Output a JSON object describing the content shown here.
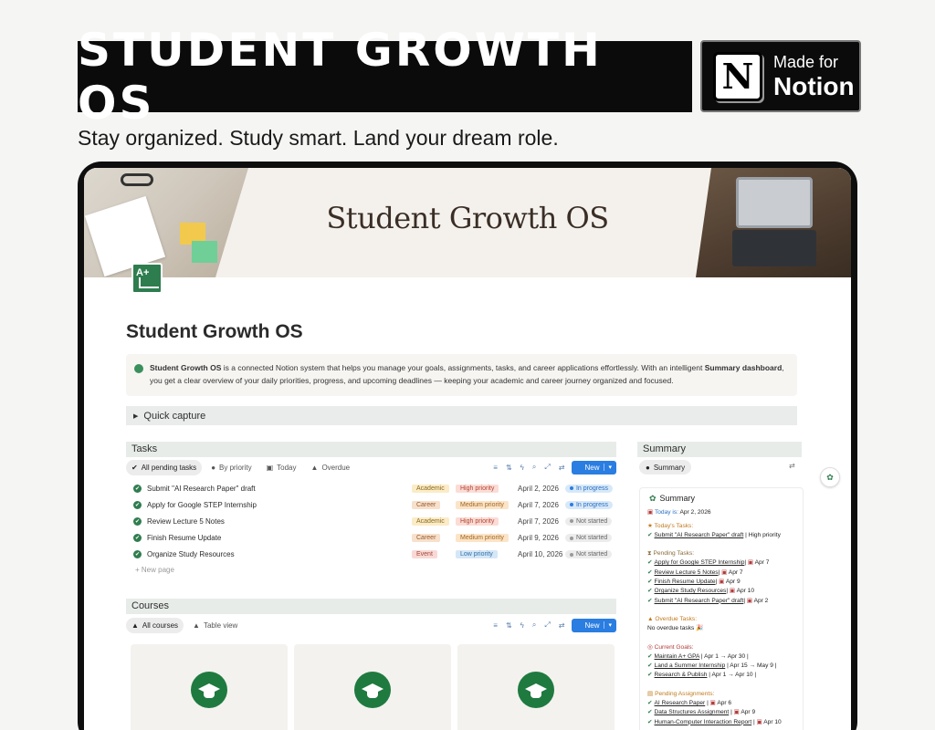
{
  "hero": {
    "title": "STUDENT GROWTH OS",
    "badge_small": "Made for",
    "badge_big": "Notion",
    "badge_logo": "N",
    "tagline": "Stay organized. Study smart. Land your dream role."
  },
  "cover": {
    "title": "Student Growth OS"
  },
  "page": {
    "icon_text": "A+",
    "title": "Student Growth OS",
    "callout_bold1": "Student Growth OS",
    "callout_text1": " is a connected Notion system that helps you manage your goals, assignments, tasks, and career applications effortlessly. With an intelligent ",
    "callout_bold2": "Summary dashboard",
    "callout_text2": ", you get a clear overview of your daily priorities, progress, and upcoming deadlines — keeping your academic and career journey organized and focused.",
    "quick_capture": "Quick capture"
  },
  "tasks": {
    "section_title": "Tasks",
    "views": [
      "All pending tasks",
      "By priority",
      "Today",
      "Overdue"
    ],
    "new_label": "New",
    "new_page": "New page",
    "rows": [
      {
        "name": "Submit \"AI Research Paper\" draft",
        "category": "Academic",
        "priority": "High priority",
        "date": "April 2, 2026",
        "status": "In progress"
      },
      {
        "name": "Apply for Google STEP Internship",
        "category": "Career",
        "priority": "Medium priority",
        "date": "April 7, 2026",
        "status": "In progress"
      },
      {
        "name": "Review Lecture 5 Notes",
        "category": "Academic",
        "priority": "High priority",
        "date": "April 7, 2026",
        "status": "Not started"
      },
      {
        "name": "Finish Resume Update",
        "category": "Career",
        "priority": "Medium priority",
        "date": "April 9, 2026",
        "status": "Not started"
      },
      {
        "name": "Organize Study Resources",
        "category": "Event",
        "priority": "Low priority",
        "date": "April 10, 2026",
        "status": "Not started"
      }
    ]
  },
  "courses": {
    "section_title": "Courses",
    "views": [
      "All courses",
      "Table view"
    ],
    "new_label": "New"
  },
  "summary": {
    "section_title": "Summary",
    "tab": "Summary",
    "card_title": "Summary",
    "today_label": "Today is:",
    "today_value": "Apr 2, 2026",
    "todays_tasks_label": "Today's Tasks:",
    "todays_task": "Submit \"AI Research Paper\" draft",
    "todays_task_meta": "| High priority",
    "pending_label": "Pending Tasks:",
    "pending": [
      {
        "name": "Apply for Google STEP Internship",
        "date": "Apr 7"
      },
      {
        "name": "Review Lecture 5 Notes",
        "date": "Apr 7"
      },
      {
        "name": "Finish Resume Update",
        "date": "Apr 9"
      },
      {
        "name": "Organize Study Resources",
        "date": "Apr 10"
      },
      {
        "name": "Submit \"AI Research Paper\" draft",
        "date": "Apr 2"
      }
    ],
    "overdue_label": "Overdue Tasks:",
    "overdue_value": "No overdue tasks 🎉",
    "goals_label": "Current Goals:",
    "goals": [
      {
        "name": "Maintain A+ GPA",
        "range": "| Apr 1 → Apr 30 |"
      },
      {
        "name": "Land a Summer Internship",
        "range": "| Apr 15 → May 9 |"
      },
      {
        "name": "Research & Publish",
        "range": "| Apr 1 → Apr 10 |"
      }
    ],
    "assign_label": "Pending Assignments:",
    "assignments": [
      {
        "name": "AI Research Paper",
        "date": "Apr 6"
      },
      {
        "name": "Data Structures Assignment",
        "date": "Apr 9"
      },
      {
        "name": "Human-Computer Interaction Report",
        "date": "Apr 10"
      }
    ]
  },
  "colors": {
    "accent_green": "#2f7d4f",
    "new_button": "#2a7de1"
  }
}
